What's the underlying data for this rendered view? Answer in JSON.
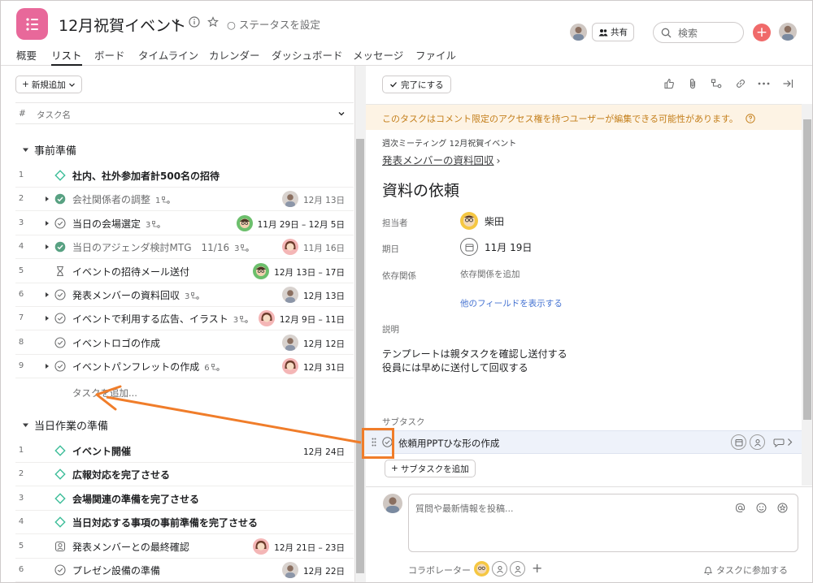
{
  "header": {
    "project_title": "12月祝賀イベント",
    "status_label": "○ ステータスを設定",
    "share_label": "共有",
    "search_placeholder": "検索",
    "plus_label": "+"
  },
  "tabs": [
    {
      "label": "概要"
    },
    {
      "label": "リスト"
    },
    {
      "label": "ボード"
    },
    {
      "label": "タイムライン"
    },
    {
      "label": "カレンダー"
    },
    {
      "label": "ダッシュボード"
    },
    {
      "label": "メッセージ"
    },
    {
      "label": "ファイル"
    }
  ],
  "active_tab": "リスト",
  "list": {
    "add_new_label": "新規追加",
    "col_hash": "#",
    "col_task": "タスク名",
    "add_task_label": "タスクを追加...",
    "sections": [
      {
        "name": "事前準備",
        "tasks": [
          {
            "num": "1",
            "name": "社内、社外参加者計500名の招待",
            "kind": "milestone",
            "bold": true,
            "sub": "",
            "date": "",
            "avatar": ""
          },
          {
            "num": "2",
            "name": "会社関係者の調整",
            "kind": "done",
            "bold": false,
            "sub": "1",
            "date": "12月 13日",
            "avatar": "woman-grey",
            "expand": true
          },
          {
            "num": "3",
            "name": "当日の会場選定",
            "kind": "check",
            "bold": false,
            "sub": "3",
            "date": "11月 29日 – 12月 5日",
            "avatar": "man-green",
            "expand": true
          },
          {
            "num": "4",
            "name": "当日のアジェンダ検討MTG　11/16",
            "kind": "done",
            "bold": false,
            "sub": "3",
            "date": "11月 16日",
            "avatar": "woman-pink",
            "expand": true
          },
          {
            "num": "5",
            "name": "イベントの招待メール送付",
            "kind": "hourglass",
            "bold": false,
            "sub": "",
            "date": "12月 13日 – 17日",
            "avatar": "man-green"
          },
          {
            "num": "6",
            "name": "発表メンバーの資料回収",
            "kind": "check",
            "bold": false,
            "sub": "3",
            "date": "12月 13日",
            "avatar": "woman-grey",
            "expand": true
          },
          {
            "num": "7",
            "name": "イベントで利用する広告、イラスト",
            "kind": "check",
            "bold": false,
            "sub": "3",
            "date": "12月 9日 – 11日",
            "avatar": "woman-pink",
            "expand": true
          },
          {
            "num": "8",
            "name": "イベントロゴの作成",
            "kind": "check",
            "bold": false,
            "sub": "",
            "date": "12月 12日",
            "avatar": "woman-grey"
          },
          {
            "num": "9",
            "name": "イベントパンフレットの作成",
            "kind": "check",
            "bold": false,
            "sub": "6",
            "date": "12月 31日",
            "avatar": "woman-pink",
            "expand": true
          }
        ]
      },
      {
        "name": "当日作業の準備",
        "tasks": [
          {
            "num": "1",
            "name": "イベント開催",
            "kind": "milestone",
            "bold": true,
            "sub": "",
            "date": "12月 24日",
            "avatar": ""
          },
          {
            "num": "2",
            "name": "広報対応を完了させる",
            "kind": "milestone",
            "bold": true,
            "sub": "",
            "date": "",
            "avatar": ""
          },
          {
            "num": "3",
            "name": "会場関連の準備を完了させる",
            "kind": "milestone",
            "bold": true,
            "sub": "",
            "date": "",
            "avatar": ""
          },
          {
            "num": "4",
            "name": "当日対応する事項の事前準備を完了させる",
            "kind": "milestone",
            "bold": true,
            "sub": "",
            "date": "",
            "avatar": ""
          },
          {
            "num": "5",
            "name": "発表メンバーとの最終確認",
            "kind": "approval",
            "bold": false,
            "sub": "",
            "date": "12月 21日 – 23日",
            "avatar": "woman-pink"
          },
          {
            "num": "6",
            "name": "プレゼン設備の準備",
            "kind": "check",
            "bold": false,
            "sub": "",
            "date": "12月 22日",
            "avatar": "woman-grey"
          }
        ]
      }
    ]
  },
  "detail": {
    "complete_label": "完了にする",
    "warning": "このタスクはコメント限定のアクセス権を持つユーザーが編集できる可能性があります。",
    "breadcrumb": "週次ミーティング  12月祝賀イベント",
    "parent_task": "発表メンバーの資料回収",
    "parent_chevron": "›",
    "title": "資料の依頼",
    "assignee_label": "担当者",
    "assignee_name": "柴田",
    "due_label": "期日",
    "due_value": "11月 19日",
    "deps_label": "依存関係",
    "deps_value": "依存関係を追加",
    "show_fields": "他のフィールドを表示する",
    "desc_label": "説明",
    "desc_line1": "テンプレートは親タスクを確認し送付する",
    "desc_line2": "役員には早めに送付して回収する",
    "subtasks_label": "サブタスク",
    "subtask_name": "依頼用PPTひな形の作成",
    "add_subtask_label": "サブタスクを追加",
    "comment_placeholder": "質問や最新情報を投稿...",
    "collaborators_label": "コラボレーター",
    "join_label": "タスクに参加する"
  },
  "colors": {
    "brand_pink": "#e8689a",
    "milestone_green": "#3dbd99",
    "done_green": "#58a182",
    "plus_red": "#f06a6a",
    "link_blue": "#4573d2",
    "warning_bg": "#fdf3e4",
    "warning_text": "#c47f1b",
    "annotation_orange": "#f07d2a"
  }
}
